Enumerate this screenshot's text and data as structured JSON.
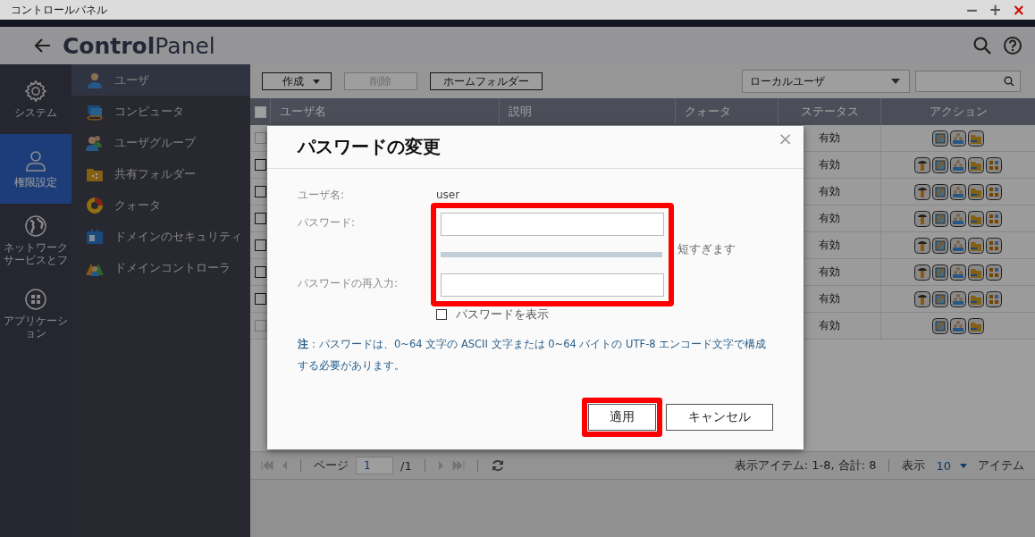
{
  "title_bar": {
    "title": "コントロールパネル",
    "controls": [
      {
        "label": "−",
        "kind": "minimize"
      },
      {
        "label": "+",
        "kind": "maximize"
      },
      {
        "label": "×",
        "kind": "close"
      }
    ]
  },
  "header": {
    "title": "**Control**Panel"
  },
  "nav": [
    {
      "label": "システム",
      "kind": "gear",
      "selected": false
    },
    {
      "label": "権限設定",
      "kind": "person",
      "selected": true
    },
    {
      "label": "ネットワークサービスとフ",
      "kind": "globe",
      "selected": false
    },
    {
      "label": "アプリケーション",
      "kind": "apps",
      "selected": false
    }
  ],
  "subnav": [
    {
      "label": "ユーザ",
      "kind": "user",
      "selected": true
    },
    {
      "label": "コンピュータ",
      "kind": "computer",
      "selected": false
    },
    {
      "label": "ユーザグループ",
      "kind": "group",
      "selected": false
    },
    {
      "label": "共有フォルダー",
      "kind": "folder",
      "selected": false
    },
    {
      "label": "クォータ",
      "kind": "quota",
      "selected": false
    },
    {
      "label": "ドメインのセキュリティ",
      "kind": "security",
      "selected": false
    },
    {
      "label": "ドメインコントローラ",
      "kind": "controller",
      "selected": false
    }
  ],
  "toolbar": {
    "buttons": [
      {
        "label": "作成",
        "kind": "menu",
        "disabled": false
      },
      {
        "label": "削除",
        "kind": "plain",
        "disabled": true
      },
      {
        "label": "ホームフォルダー",
        "kind": "plain",
        "disabled": false
      }
    ],
    "filter": "ローカルユーザ"
  },
  "table": {
    "columns": [
      "ユーザ名",
      "説明",
      "クォータ",
      "ステータス",
      "アクション"
    ],
    "header_checked": false,
    "rows": [
      {
        "checked": false,
        "disabled": true,
        "status": "有効",
        "kind": "builtin"
      },
      {
        "checked": false,
        "disabled": false,
        "status": "有効",
        "kind": "regular"
      },
      {
        "checked": false,
        "disabled": false,
        "status": "有効",
        "kind": "regular"
      },
      {
        "checked": false,
        "disabled": false,
        "status": "有効",
        "kind": "regular"
      },
      {
        "checked": false,
        "disabled": false,
        "status": "有効",
        "kind": "regular"
      },
      {
        "checked": false,
        "disabled": false,
        "status": "有効",
        "kind": "regular"
      },
      {
        "checked": false,
        "disabled": false,
        "status": "有効",
        "kind": "regular"
      },
      {
        "checked": false,
        "disabled": true,
        "status": "有効",
        "kind": "builtin"
      }
    ]
  },
  "pager": {
    "page_label": "ページ",
    "page": "1",
    "of": "/1",
    "summary": "表示アイテム: 1-8, 合計: 8",
    "show_label": "表示",
    "per_page": "10",
    "unit": "アイテム"
  },
  "dialog": {
    "title": "パスワードの変更",
    "close": "×",
    "username_label": "ユーザ名:",
    "username": "user",
    "password_label": "パスワード:",
    "strength": "短すぎます",
    "confirm_label": "パスワードの再入力:",
    "fields_highlighted": true,
    "show_password": {
      "label": "パスワードを表示",
      "checked": false
    },
    "note": "**注**：パスワードは、0~64 文字の ASCII 文字または 0~64 バイトの UTF-8 エンコード文字で構成する必要があります。",
    "buttons": [
      {
        "label": "適用",
        "kind": "primary",
        "highlighted": true
      },
      {
        "label": "キャンセル",
        "kind": "secondary",
        "highlighted": false
      }
    ]
  }
}
